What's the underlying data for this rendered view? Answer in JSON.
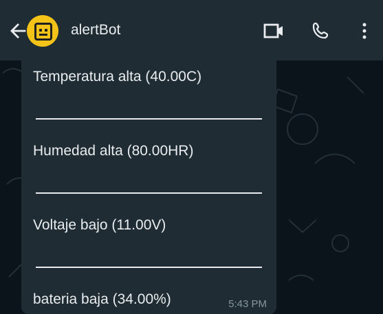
{
  "header": {
    "title": "alertBot",
    "back_icon": "arrow-left-icon",
    "avatar_icon": "robot-face-icon",
    "video_icon": "video-call-icon",
    "phone_icon": "phone-icon",
    "menu_icon": "more-vertical-icon"
  },
  "message": {
    "lines": [
      "Temperatura alta (40.00C)",
      "Humedad alta (80.00HR)",
      "Voltaje bajo (11.00V)",
      "bateria baja (34.00%)"
    ],
    "time": "5:43 PM"
  },
  "colors": {
    "header_bg": "#1f2c34",
    "chat_bg": "#0b141a",
    "bubble_bg": "#1f2c34",
    "text": "#e9edef",
    "muted_text": "#8696a0",
    "avatar": "#f3c318"
  }
}
